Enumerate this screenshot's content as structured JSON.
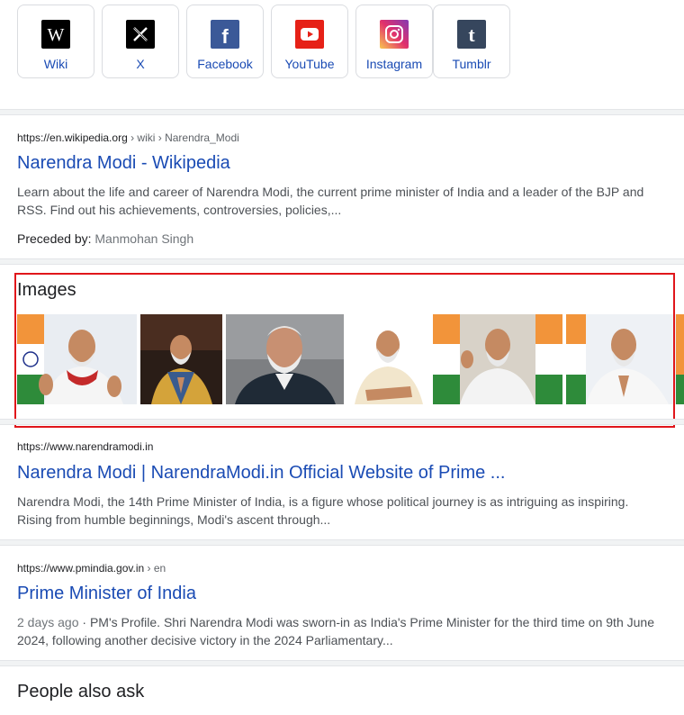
{
  "social": [
    {
      "label": "Wiki",
      "icon": "wikipedia-icon"
    },
    {
      "label": "X",
      "icon": "x-icon"
    },
    {
      "label": "Facebook",
      "icon": "facebook-icon"
    },
    {
      "label": "YouTube",
      "icon": "youtube-icon"
    },
    {
      "label": "Instagram",
      "icon": "instagram-icon"
    },
    {
      "label": "Tumblr",
      "icon": "tumblr-icon"
    }
  ],
  "results": [
    {
      "domain": "https://en.wikipedia.org",
      "path": " › wiki › Narendra_Modi",
      "title": "Narendra Modi - Wikipedia",
      "snippet": "Learn about the life and career of Narendra Modi, the current prime minister of India and a leader of the BJP and RSS. Find out his achievements, controversies, policies,...",
      "fact_label": "Preceded by:",
      "fact_value": "Manmohan Singh"
    },
    {
      "domain": "https://www.narendramodi.in",
      "title": "Narendra Modi | NarendraModi.in Official Website of Prime ...",
      "snippet": "Narendra Modi, the 14th Prime Minister of India, is a figure whose political journey is as intriguing as inspiring. Rising from humble beginnings, Modi's ascent through..."
    },
    {
      "domain": "https://www.pmindia.gov.in",
      "path": " › en",
      "title": "Prime Minister of India",
      "date": "2 days ago",
      "snippet": " · PM's Profile. Shri Narendra Modi was sworn-in as India's Prime Minister for the third time on 9th June 2024, following another decisive victory in the 2024 Parliamentary..."
    }
  ],
  "images_heading": "Images",
  "image_thumbs": [
    "image-thumbnail-1",
    "image-thumbnail-2",
    "image-thumbnail-3",
    "image-thumbnail-4",
    "image-thumbnail-5",
    "image-thumbnail-6"
  ],
  "paa_heading": "People also ask",
  "colors": {
    "link": "#1a4bb4",
    "highlight": "#e0161b"
  }
}
